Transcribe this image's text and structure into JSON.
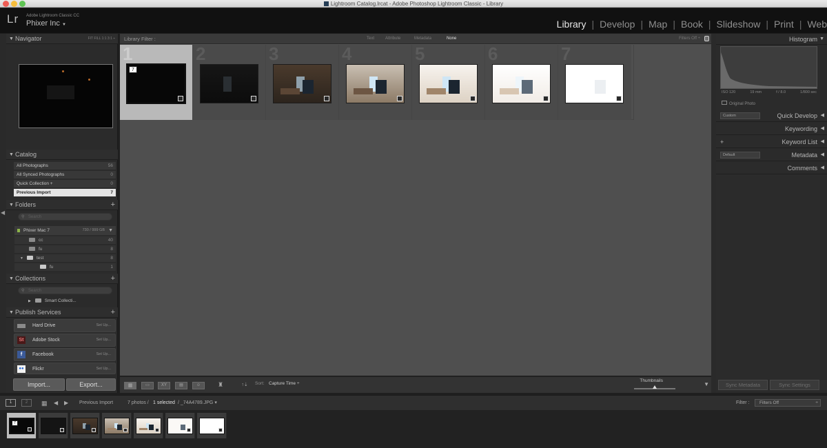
{
  "window": {
    "title": "Lightroom Catalog.lrcat - Adobe Photoshop Lightroom Classic - Library"
  },
  "identity": {
    "logo": "Lr",
    "product": "Adobe Lightroom Classic CC",
    "company": "Phixer Inc",
    "company_arrow": "▼"
  },
  "modules": [
    {
      "label": "Library",
      "active": true
    },
    {
      "label": "Develop",
      "active": false
    },
    {
      "label": "Map",
      "active": false
    },
    {
      "label": "Book",
      "active": false
    },
    {
      "label": "Slideshow",
      "active": false
    },
    {
      "label": "Print",
      "active": false
    },
    {
      "label": "Web",
      "active": false
    }
  ],
  "left": {
    "navigator": {
      "title": "Navigator",
      "opts": "FIT   FILL   1:1   3:1 ÷"
    },
    "catalog": {
      "title": "Catalog",
      "items": [
        {
          "label": "All Photographs",
          "count": "56"
        },
        {
          "label": "All Synced Photographs",
          "count": "0"
        },
        {
          "label": "Quick Collection +",
          "count": "0"
        },
        {
          "label": "Previous Import",
          "count": "7"
        }
      ]
    },
    "folders": {
      "title": "Folders",
      "search_placeholder": "Search",
      "volume": {
        "name": "Phixer Mac 7",
        "capacity": "730 / 999 GB"
      },
      "items": [
        {
          "label": "cc",
          "count": "40"
        },
        {
          "label": "fu",
          "count": "8"
        },
        {
          "label": "test",
          "count": "8"
        },
        {
          "label": "fu",
          "count": "1"
        }
      ]
    },
    "collections": {
      "title": "Collections",
      "search_placeholder": "Search",
      "smart": "Smart Collecti..."
    },
    "publish": {
      "title": "Publish Services",
      "items": [
        {
          "label": "Hard Drive",
          "action": "Set Up...",
          "icon": "HD",
          "icon_name": "hard-drive-icon"
        },
        {
          "label": "Adobe Stock",
          "action": "Set Up...",
          "icon": "St",
          "icon_name": "adobe-stock-icon"
        },
        {
          "label": "Facebook",
          "action": "Set Up...",
          "icon": "f",
          "icon_name": "facebook-icon"
        },
        {
          "label": "Flickr",
          "action": "Set Up...",
          "icon": "●●",
          "icon_name": "flickr-icon"
        }
      ]
    },
    "import_label": "Import...",
    "export_label": "Export..."
  },
  "filterbar": {
    "label": "Library Filter :",
    "tabs": [
      "Text",
      "Attribute",
      "Metadata",
      "None"
    ],
    "active_tab": "None",
    "filters_off": "Filters Off ÷"
  },
  "grid": {
    "cells": [
      {
        "number": "1",
        "badge": "7",
        "selected": true,
        "tone": "dark0"
      },
      {
        "number": "2",
        "selected": false,
        "tone": "dark1"
      },
      {
        "number": "3",
        "selected": false,
        "tone": "mid"
      },
      {
        "number": "4",
        "selected": false,
        "tone": "bright1"
      },
      {
        "number": "5",
        "selected": false,
        "tone": "bright2"
      },
      {
        "number": "6",
        "selected": false,
        "tone": "bright3"
      },
      {
        "number": "7",
        "selected": false,
        "tone": "white"
      }
    ]
  },
  "toolbar": {
    "sort_label": "Sort:",
    "sort_value": "Capture Time ÷",
    "thumbnails_label": "Thumbnails",
    "thumbnail_size": 0.6
  },
  "right": {
    "histogram": {
      "title": "Histogram",
      "iso": "ISO 120",
      "focal": "19 mm",
      "aperture": "f / 8.0",
      "shutter": "1/800 sec",
      "original": "Original Photo"
    },
    "quick_develop": {
      "title": "Quick Develop",
      "preset": "Custom"
    },
    "keywording": "Keywording",
    "keyword_list": {
      "title": "Keyword List",
      "plus": "+"
    },
    "metadata": {
      "title": "Metadata",
      "preset": "Default"
    },
    "comments": "Comments",
    "sync_metadata": "Sync Metadata",
    "sync_settings": "Sync Settings"
  },
  "filmstrip": {
    "view1": "1",
    "view2": "2",
    "source": "Previous Import",
    "count_text": "7 photos /",
    "selected_text": "1 selected",
    "file_text": "/ _74A4789.JPG ▾",
    "filter_label": "Filter :",
    "filter_value": "Filters Off"
  },
  "colors": {
    "bg": "#1f1f1f",
    "panel": "#2b2b2b",
    "grid": "#4f4f4f",
    "selected": "#b9b9b9",
    "active_module": "#e6e6e6"
  }
}
